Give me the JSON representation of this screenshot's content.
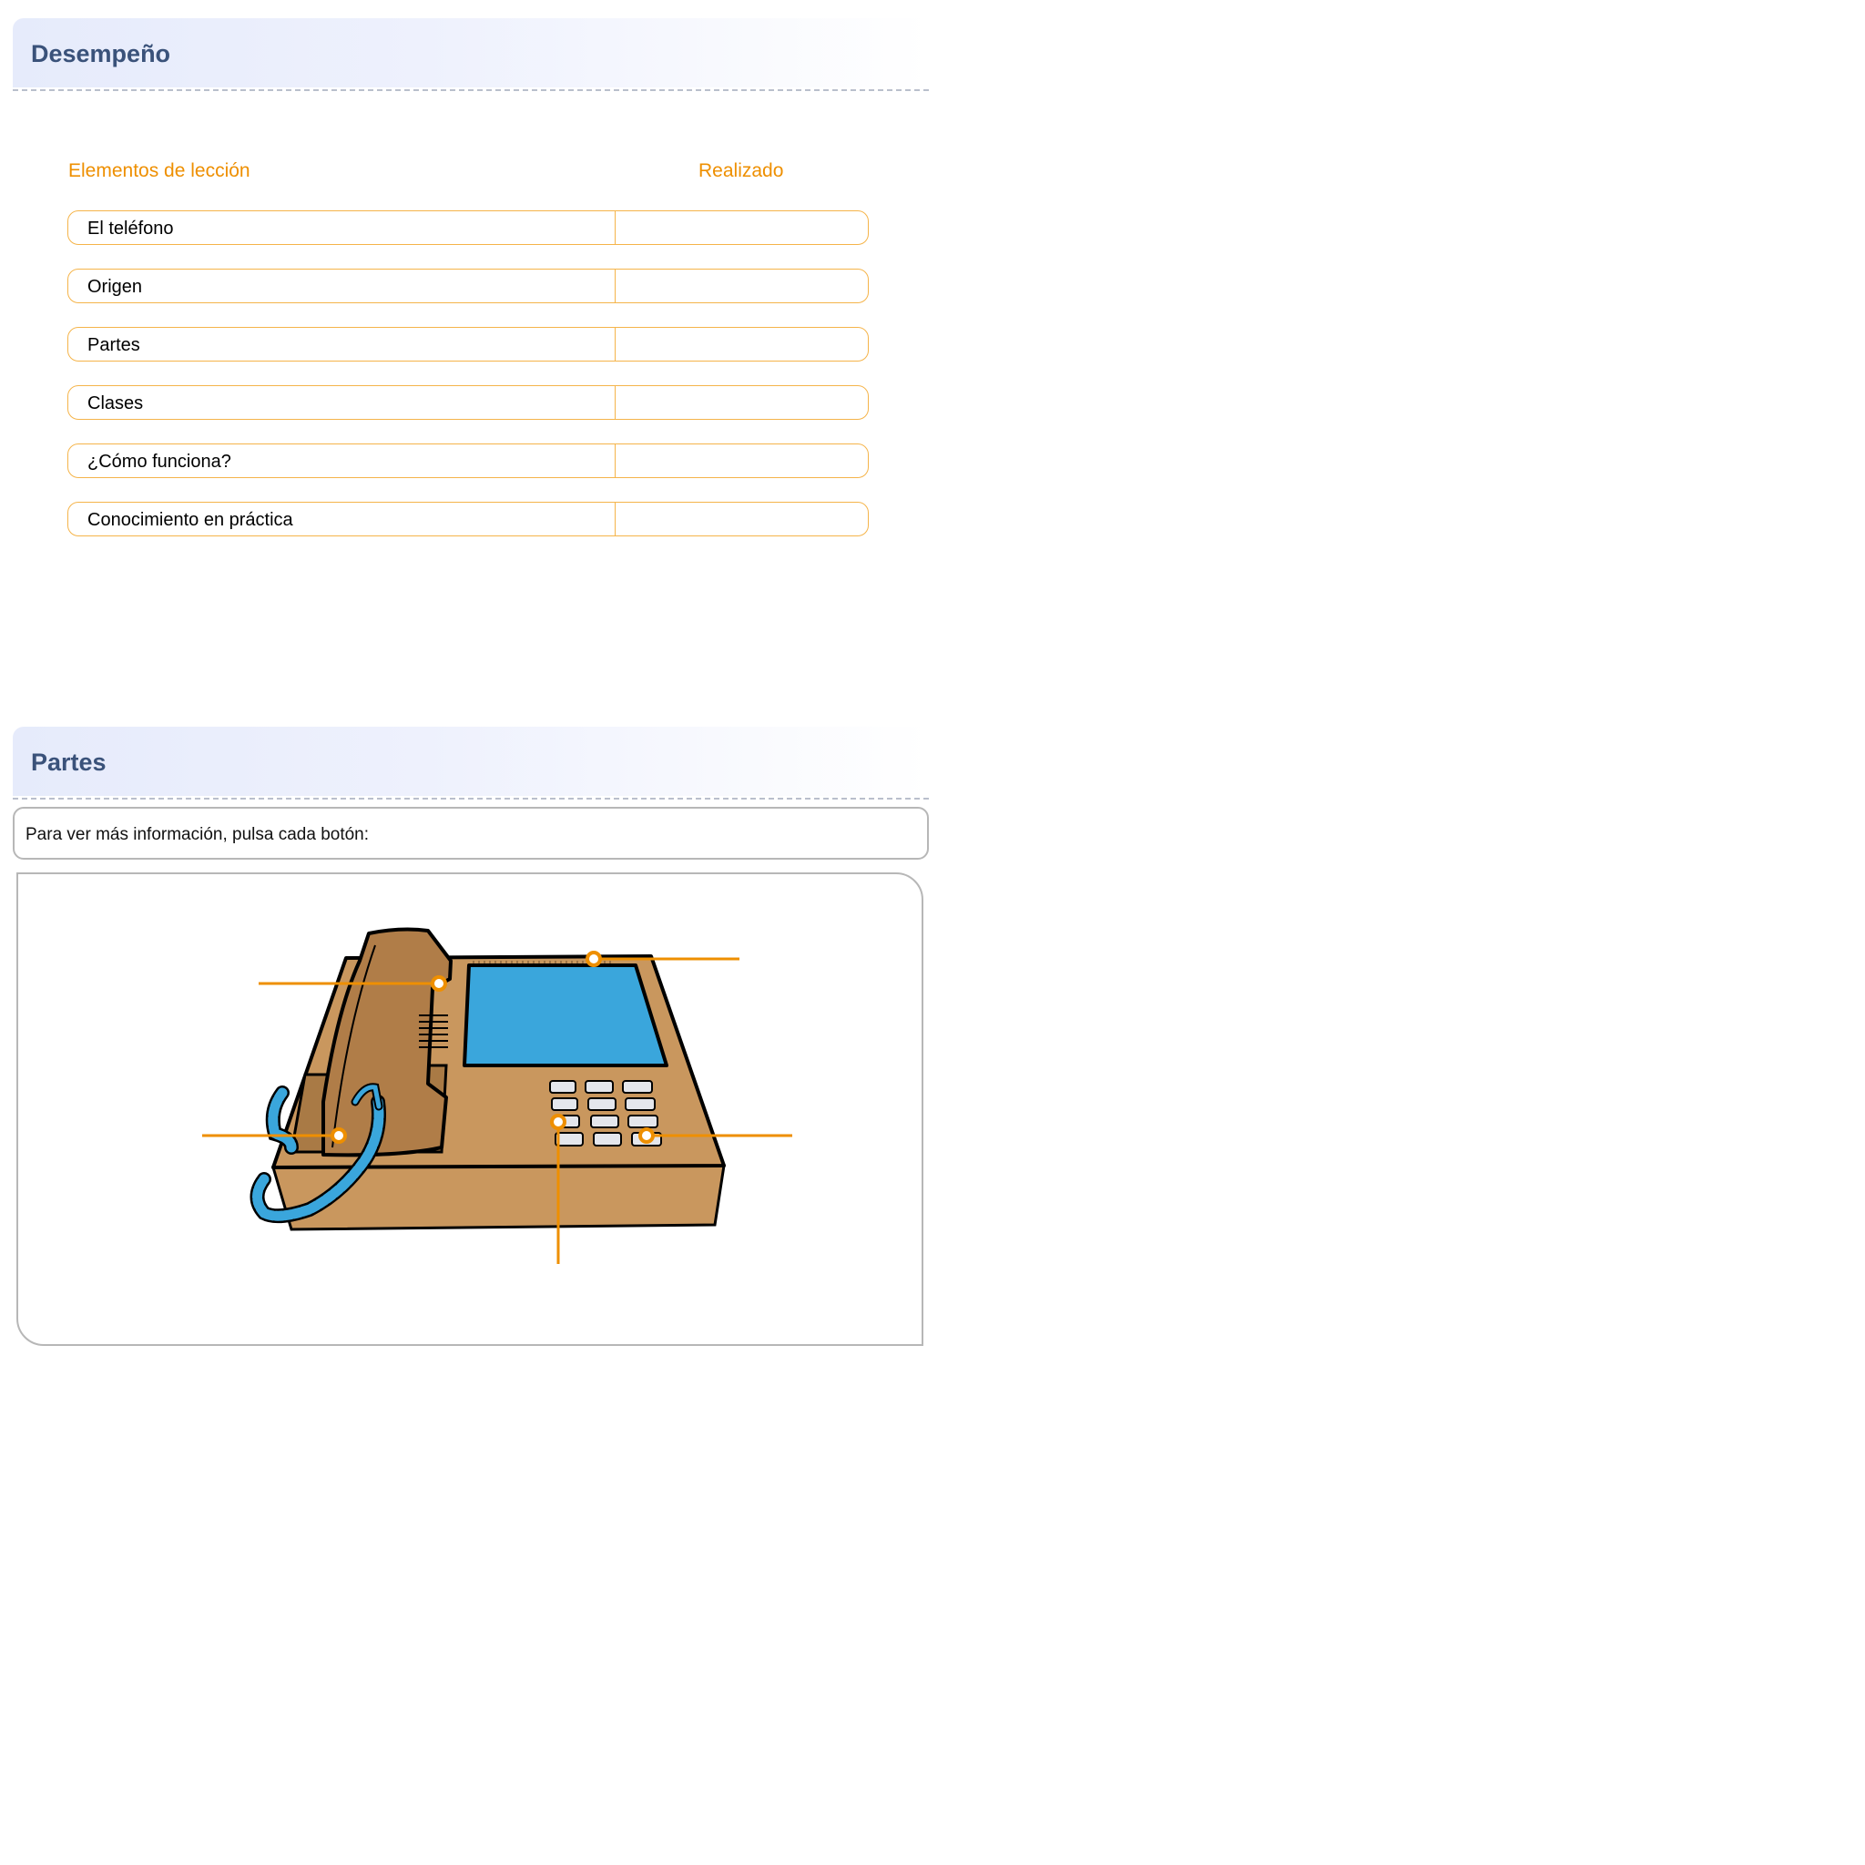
{
  "desempeno": {
    "title": "Desempeño",
    "col_elements": "Elementos de lección",
    "col_done": "Realizado",
    "rows": [
      {
        "label": "El teléfono",
        "done": ""
      },
      {
        "label": "Origen",
        "done": ""
      },
      {
        "label": "Partes",
        "done": ""
      },
      {
        "label": "Clases",
        "done": ""
      },
      {
        "label": "¿Cómo funciona?",
        "done": ""
      },
      {
        "label": "Conocimiento en práctica",
        "done": ""
      }
    ]
  },
  "partes": {
    "title": "Partes",
    "instructions": "Para ver más información, pulsa cada botón:"
  },
  "colors": {
    "accent": "#ee8f00",
    "title": "#3a527a",
    "phone_body": "#c9975e",
    "phone_handset": "#b07d48",
    "screen": "#3aa6dc",
    "cord": "#3aa6dc"
  }
}
